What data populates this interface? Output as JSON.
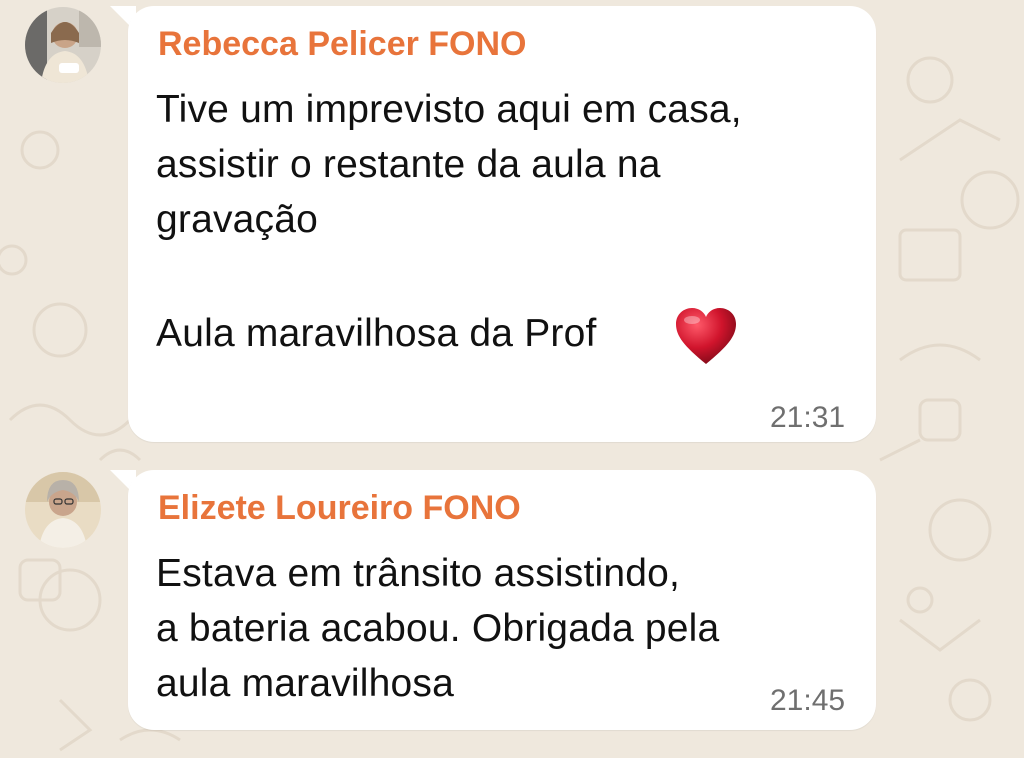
{
  "messages": [
    {
      "sender": "Rebecca Pelicer FONO",
      "lines": [
        "Tive um imprevisto aqui em casa,",
        "assistir o restante da aula na",
        "gravação",
        "Aula maravilhosa da Prof"
      ],
      "emoji": "heart-emoji",
      "time": "21:31"
    },
    {
      "sender": "Elizete Loureiro FONO",
      "lines": [
        "Estava em trânsito assistindo,",
        "a bateria acabou. Obrigada pela",
        "aula maravilhosa"
      ],
      "time": "21:45"
    }
  ],
  "colors": {
    "background": "#efe8dd",
    "bubble": "#ffffff",
    "sender_name": "#e8743b",
    "time": "#6f6f6f",
    "heart": "#c8102e"
  }
}
